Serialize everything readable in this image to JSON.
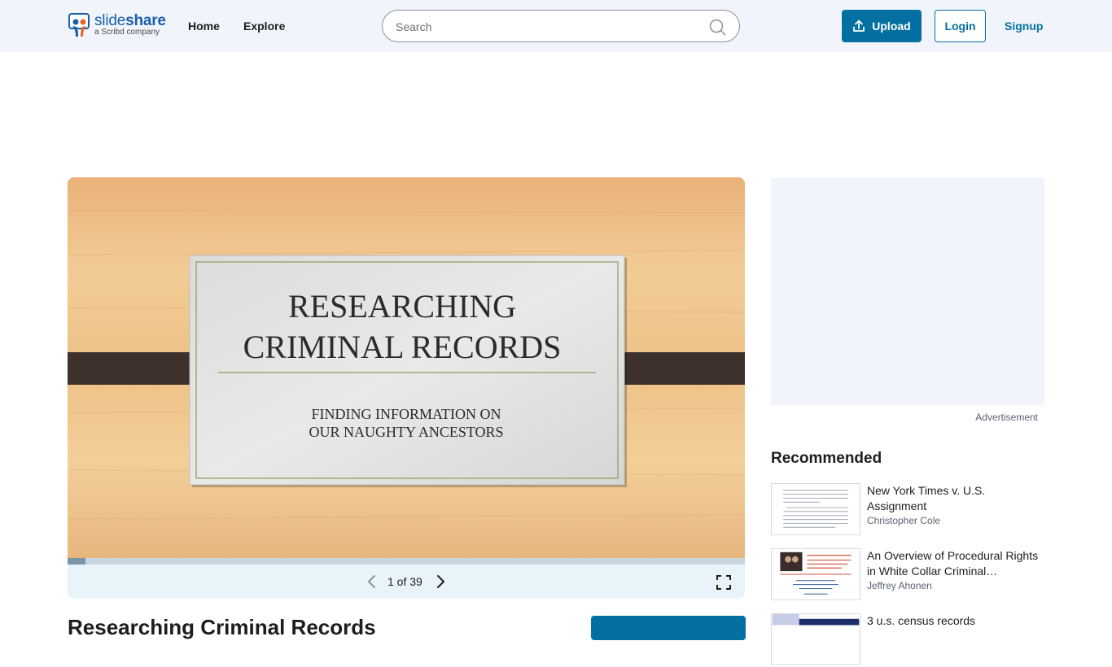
{
  "header": {
    "logo_word_light": "slide",
    "logo_word_bold": "share",
    "logo_sub": "a Scribd company",
    "nav": [
      "Home",
      "Explore"
    ],
    "search_placeholder": "Search",
    "upload_label": "Upload",
    "login_label": "Login",
    "signup_label": "Signup"
  },
  "slide": {
    "title_line1": "RESEARCHING",
    "title_line2": "CRIMINAL RECORDS",
    "subtitle_line1": "FINDING INFORMATION ON",
    "subtitle_line2": "OUR NAUGHTY ANCESTORS"
  },
  "viewer": {
    "page_indicator": "1 of 39",
    "progress": 0.026
  },
  "sidebar": {
    "ad_label": "Advertisement",
    "recommended_title": "Recommended",
    "items": [
      {
        "title": "New York Times v. U.S. Assignment",
        "author": "Christopher Cole"
      },
      {
        "title": "An Overview of Procedural Rights in White Collar Criminal…",
        "author": "Jeffrey Ahonen"
      },
      {
        "title": "3 u.s. census records",
        "author": ""
      }
    ]
  },
  "document": {
    "title": "Researching Criminal Records"
  },
  "colors": {
    "brand": "#0470a1",
    "header_bg": "#f1f5fb"
  }
}
